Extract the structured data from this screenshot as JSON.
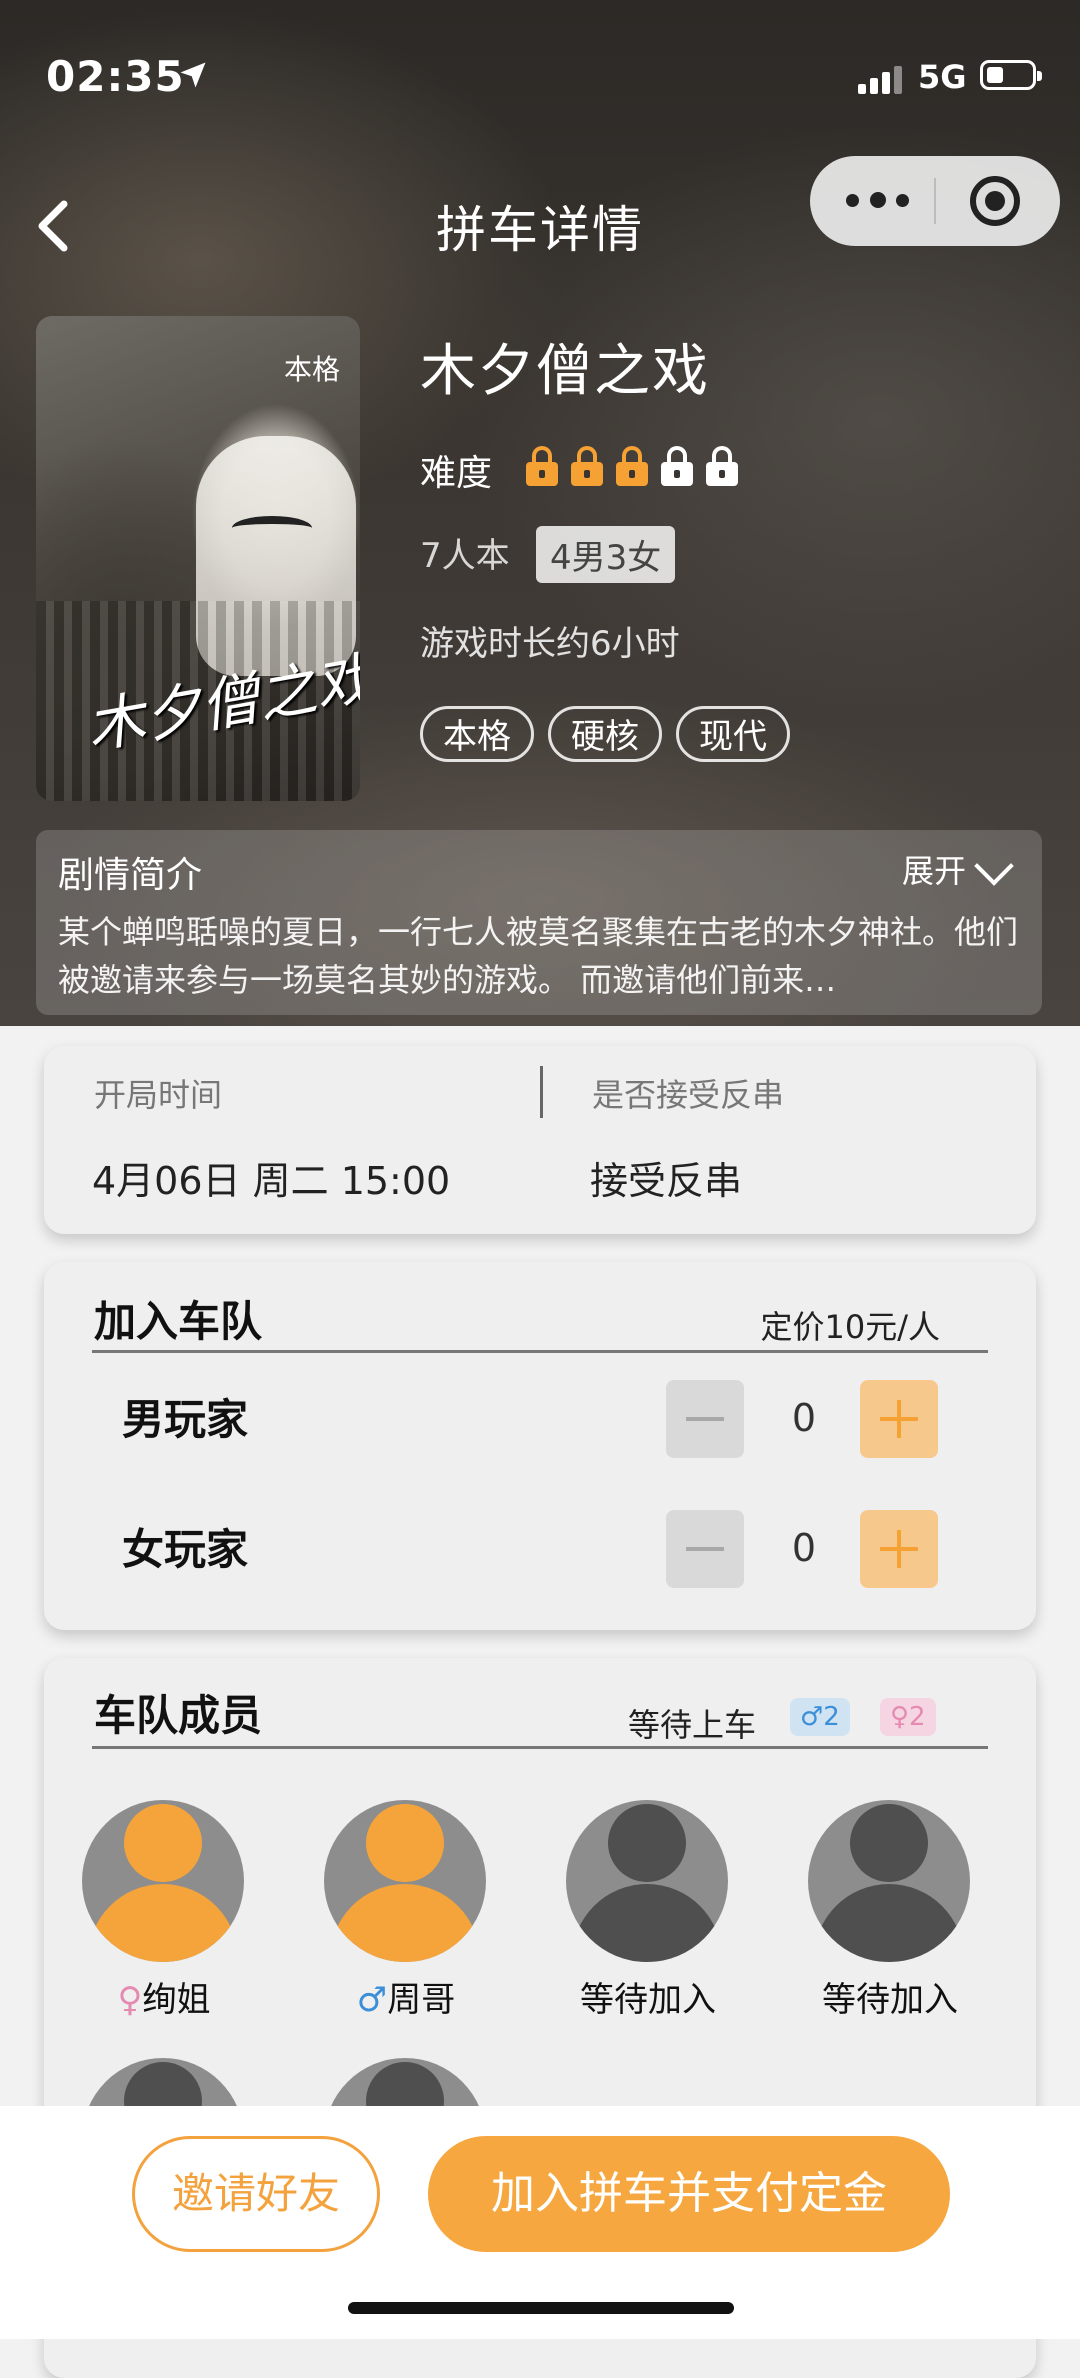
{
  "status_bar": {
    "time": "02:35",
    "network": "5G"
  },
  "nav": {
    "title": "拼车详情"
  },
  "script": {
    "poster_title": "木夕僧之戏",
    "poster_badge": "本格",
    "name": "木夕僧之戏",
    "difficulty_label": "难度",
    "difficulty": {
      "level": 3,
      "max": 5
    },
    "player_count": "7人本",
    "gender_split": "4男3女",
    "duration": "游戏时长约6小时",
    "tags": [
      "本格",
      "硬核",
      "现代"
    ]
  },
  "synopsis": {
    "title": "剧情简介",
    "expand_label": "展开",
    "text": "某个蝉鸣聒噪的夏日，一行七人被莫名聚集在古老的木夕神社。他们被邀请来参与一场莫名其妙的游戏。 而邀请他们前来…"
  },
  "session": {
    "start_label": "开局时间",
    "start_value": "4月06日 周二 15:00",
    "cross_label": "是否接受反串",
    "cross_value": "接受反串"
  },
  "join": {
    "title": "加入车队",
    "price": "定价10元/人",
    "rows": [
      {
        "label": "男玩家",
        "count": "0"
      },
      {
        "label": "女玩家",
        "count": "0"
      }
    ]
  },
  "members": {
    "title": "车队成员",
    "waiting_label": "等待上车",
    "male_waiting": "♂2",
    "female_waiting": "♀2",
    "list": [
      {
        "name": "绚姐",
        "gender_symbol": "♀",
        "avatar": "orange"
      },
      {
        "name": "周哥",
        "gender_symbol": "♂",
        "avatar": "orange"
      },
      {
        "name": "等待加入",
        "gender_symbol": "",
        "avatar": "grey"
      },
      {
        "name": "等待加入",
        "gender_symbol": "",
        "avatar": "grey"
      }
    ]
  },
  "actions": {
    "invite": "邀请好友",
    "join": "加入拼车并支付定金"
  },
  "colors": {
    "accent": "#f5a134",
    "accent_light": "#f7c88c",
    "male": "#3b8fd9",
    "female": "#e58ab0"
  },
  "icons": [
    "back-icon",
    "more-icon",
    "target-icon",
    "location-arrow-icon",
    "lock-icon",
    "chevron-down-icon",
    "minus-icon",
    "plus-icon",
    "avatar-icon"
  ]
}
